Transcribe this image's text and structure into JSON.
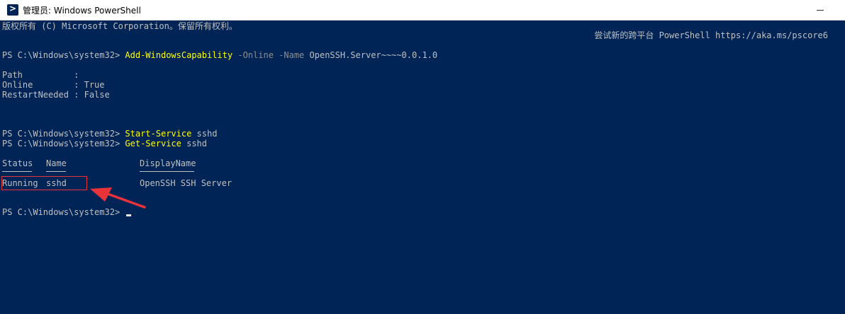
{
  "window": {
    "title": "管理员: Windows PowerShell",
    "icon": "powershell-icon",
    "background": "#012456"
  },
  "console": {
    "copyright": "版权所有 (C) Microsoft Corporation。保留所有权利。",
    "hint": "尝试新的跨平台 PowerShell https://aka.ms/pscore6",
    "prompt": "PS C:\\Windows\\system32> ",
    "cmd1": {
      "name": "Add-WindowsCapability",
      "p1": "-Online",
      "p2": "-Name",
      "arg": "OpenSSH.Server~~~~0.0.1.0"
    },
    "output": [
      "Path          :",
      "Online        : True",
      "RestartNeeded : False"
    ],
    "cmd2": {
      "name": "Start-Service",
      "arg": "sshd"
    },
    "cmd3": {
      "name": "Get-Service",
      "arg": "sshd"
    },
    "table": {
      "headers": [
        "Status",
        "Name",
        "DisplayName"
      ],
      "row": [
        "Running",
        "sshd",
        "OpenSSH SSH Server"
      ]
    }
  },
  "colors": {
    "command": "#ffff00",
    "parameter": "#8e8e8e",
    "annotation": "#e8333a"
  }
}
